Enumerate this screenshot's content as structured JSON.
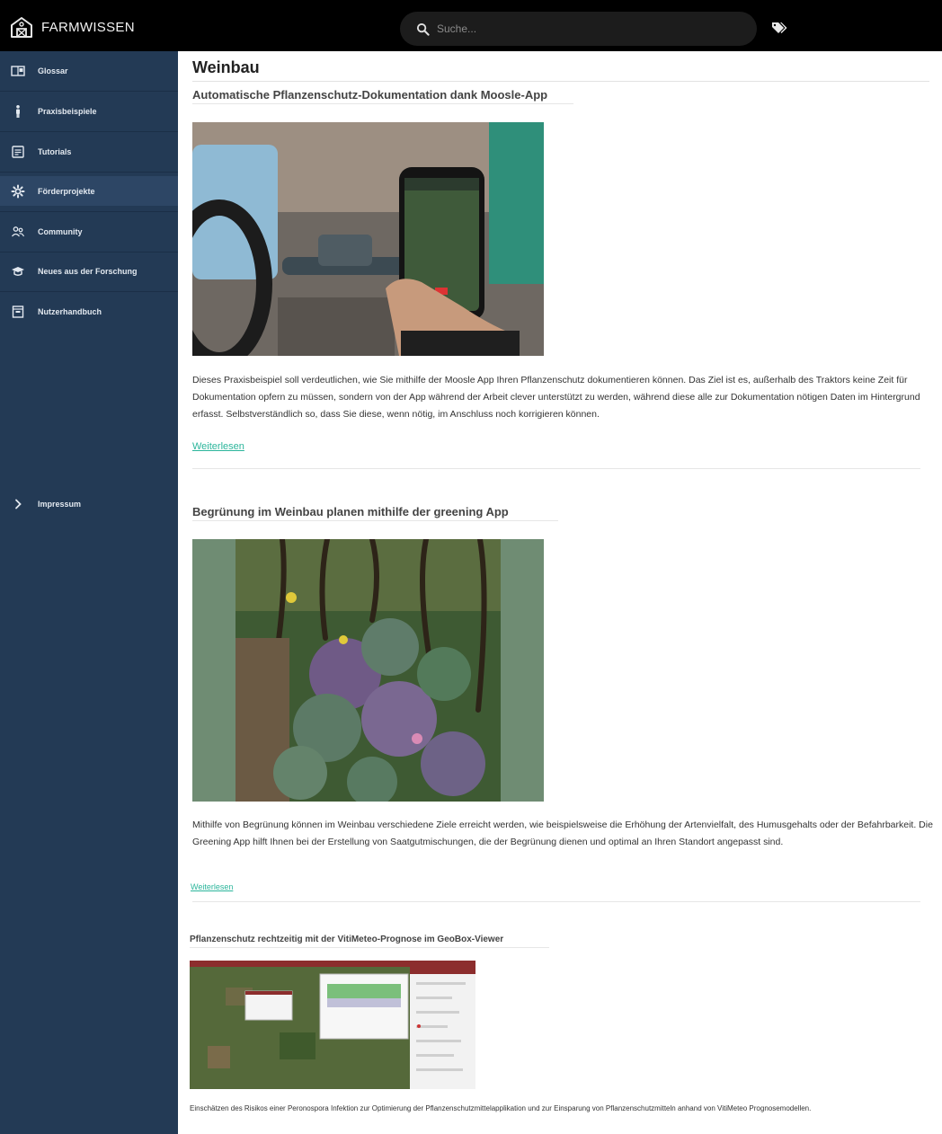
{
  "header": {
    "brand": "FARMWISSEN",
    "search_placeholder": "Suche..."
  },
  "sidebar": {
    "items": [
      {
        "label": "Glossar",
        "icon": "glossary-icon"
      },
      {
        "label": "Praxisbeispiele",
        "icon": "person-icon"
      },
      {
        "label": "Tutorials",
        "icon": "tutorial-icon"
      },
      {
        "label": "Förderprojekte",
        "icon": "gear-icon",
        "active": true
      },
      {
        "label": "Community",
        "icon": "community-icon"
      },
      {
        "label": "Neues aus der Forschung",
        "icon": "graduation-cap-icon"
      },
      {
        "label": "Nutzerhandbuch",
        "icon": "manual-icon"
      }
    ],
    "impressum": "Impressum"
  },
  "main": {
    "page_title": "Weinbau",
    "articles": [
      {
        "title": "Automatische Pflanzenschutz-Dokumentation dank Moosle-App",
        "text": "Dieses Praxisbeispiel soll verdeutlichen, wie Sie mithilfe der Moosle App Ihren Pflanzenschutz dokumentieren können. Das Ziel ist es, außerhalb des Traktors keine Zeit für Dokumentation opfern zu müssen, sondern von der App während der Arbeit clever unterstützt zu werden, während diese alle zur Dokumentation nötigen Daten im Hintergrund erfasst. Selbstverständlich so, dass Sie diese, wenn nötig, im Anschluss noch korrigieren können.",
        "read_more": "Weiterlesen"
      },
      {
        "title": "Begrünung im Weinbau planen mithilfe der greening App",
        "text": "Mithilfe von Begrünung können im Weinbau verschiedene Ziele erreicht werden, wie beispielsweise die Erhöhung der Artenvielfalt, des Humusgehalts oder der Befahrbarkeit. Die Greening App hilft Ihnen bei der Erstellung von Saatgutmischungen, die der Begrünung dienen und optimal an Ihren Standort angepasst sind.",
        "read_more": "Weiterlesen"
      },
      {
        "title": "Pflanzenschutz rechtzeitig mit der VitiMeteo-Prognose im GeoBox-Viewer",
        "text": "Einschätzen des Risikos einer Peronospora Infektion zur Optimierung der Pflanzenschutzmittelapplikation und zur Einsparung von Pflanzenschutzmitteln anhand von VitiMeteo Prognosemodellen."
      }
    ]
  },
  "colors": {
    "topbar": "#000000",
    "sidebar": "#233a55",
    "sidebar_active": "#2d4665",
    "link": "#2bb59b"
  }
}
